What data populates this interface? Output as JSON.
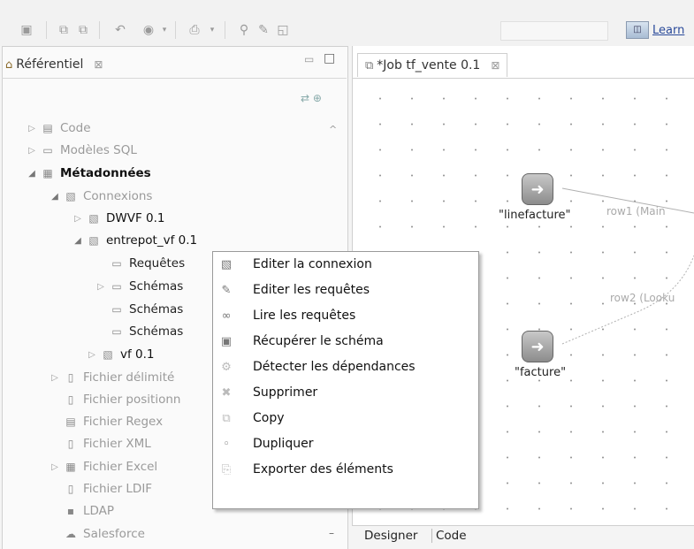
{
  "toolbar": {
    "icons": [
      "save-icon",
      "copy-icon",
      "paste-icon",
      "undo-icon",
      "run-icon",
      "export-icon",
      "zoom-icon",
      "edit-icon",
      "layout-icon"
    ],
    "learn_label": "Learn"
  },
  "left_panel": {
    "tab_title": "Référentiel",
    "close_glyph": "⊠",
    "tree": [
      {
        "label": "Code"
      },
      {
        "label": "Modèles SQL"
      },
      {
        "label": "Métadonnées"
      },
      {
        "label": "Connexions"
      },
      {
        "label": "DWVF 0.1"
      },
      {
        "label": "entrepot_vf 0.1"
      },
      {
        "label": "Requêtes"
      },
      {
        "label": "Schémas"
      },
      {
        "label": "Schémas"
      },
      {
        "label": "Schémas"
      },
      {
        "label": "vf 0.1"
      },
      {
        "label": "Fichier délimité"
      },
      {
        "label": "Fichier positionn"
      },
      {
        "label": "Fichier Regex"
      },
      {
        "label": "Fichier XML"
      },
      {
        "label": "Fichier Excel"
      },
      {
        "label": "Fichier LDIF"
      },
      {
        "label": "LDAP"
      },
      {
        "label": "Salesforce"
      }
    ]
  },
  "editor": {
    "tab_title": "*Job tf_vente 0.1",
    "close_glyph": "⊠",
    "components": [
      {
        "label": "\"linefacture\""
      },
      {
        "label": "\"facture\""
      }
    ],
    "connections": [
      "row1 (Main",
      "row2 (Looku"
    ],
    "bottom_tabs": [
      "Designer",
      "Code"
    ]
  },
  "context_menu": {
    "items": [
      {
        "label": "Editer la connexion",
        "icon": "connection-icon"
      },
      {
        "label": "Editer les requêtes",
        "icon": "pencil-icon"
      },
      {
        "label": "Lire les requêtes",
        "icon": "glasses-icon"
      },
      {
        "label": "Récupérer le schéma",
        "icon": "schema-icon"
      },
      {
        "label": "Détecter les dépendances",
        "icon": "dependencies-icon"
      },
      {
        "label": "Supprimer",
        "icon": "delete-icon"
      },
      {
        "label": "Copy",
        "icon": "copy-icon"
      },
      {
        "label": "Dupliquer",
        "icon": "duplicate-icon"
      },
      {
        "label": "Exporter des éléments",
        "icon": "export-icon"
      }
    ]
  }
}
